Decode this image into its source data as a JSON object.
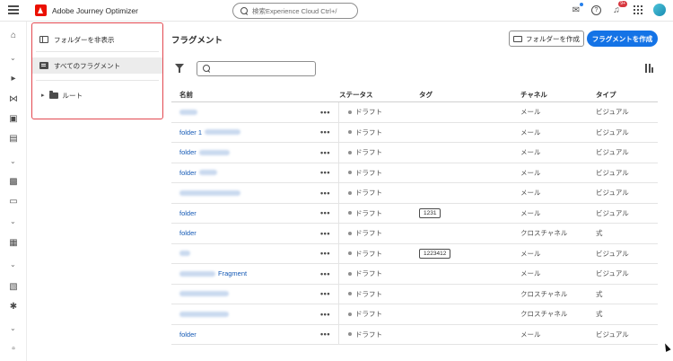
{
  "app": {
    "brand_name": "Adobe Journey Optimizer",
    "search_placeholder": "検索Experience Cloud Ctrl+/",
    "notifications_count": "9+"
  },
  "folder_panel": {
    "hide_folders_label": "フォルダーを非表示",
    "all_fragments_label": "すべてのフラグメント",
    "root_label": "ルート"
  },
  "main": {
    "title": "フラグメント",
    "create_folder_label": "フォルダーを作成",
    "create_fragment_label": "フラグメントを作成",
    "search_value": ""
  },
  "table": {
    "headers": {
      "name": "名前",
      "status": "ステータス",
      "tag": "タグ",
      "channel": "チャネル",
      "type": "タイプ"
    },
    "rows": [
      {
        "name": "",
        "blur_w": 20,
        "status": "ドラフト",
        "tag": "",
        "channel": "メール",
        "type": "ビジュアル"
      },
      {
        "name": "folder 1",
        "blur_w": 40,
        "status": "ドラフト",
        "tag": "",
        "channel": "メール",
        "type": "ビジュアル"
      },
      {
        "name": "folder",
        "blur_w": 34,
        "status": "ドラフト",
        "tag": "",
        "channel": "メール",
        "type": "ビジュアル"
      },
      {
        "name": "folder",
        "blur_w": 20,
        "status": "ドラフト",
        "tag": "",
        "channel": "メール",
        "type": "ビジュアル"
      },
      {
        "name": "",
        "blur_w": 68,
        "status": "ドラフト",
        "tag": "",
        "channel": "メール",
        "type": "ビジュアル"
      },
      {
        "name": "folder",
        "blur_w": 0,
        "status": "ドラフト",
        "tag": "1231",
        "channel": "メール",
        "type": "ビジュアル"
      },
      {
        "name": "folder",
        "blur_w": 0,
        "status": "ドラフト",
        "tag": "",
        "channel": "クロスチャネル",
        "type": "式"
      },
      {
        "name": "",
        "blur_w": 12,
        "status": "ドラフト",
        "tag": "1223412",
        "channel": "メール",
        "type": "ビジュアル"
      },
      {
        "name": "Fragment",
        "blur_w": 40,
        "status": "ドラフト",
        "tag": "",
        "channel": "メール",
        "type": "ビジュアル"
      },
      {
        "name": "",
        "blur_w": 55,
        "status": "ドラフト",
        "tag": "",
        "channel": "クロスチャネル",
        "type": "式"
      },
      {
        "name": "",
        "blur_w": 55,
        "status": "ドラフト",
        "tag": "",
        "channel": "クロスチャネル",
        "type": "式"
      },
      {
        "name": "folder",
        "blur_w": 0,
        "status": "ドラフト",
        "tag": "",
        "channel": "メール",
        "type": "ビジュアル"
      }
    ],
    "more_label": "•••"
  }
}
